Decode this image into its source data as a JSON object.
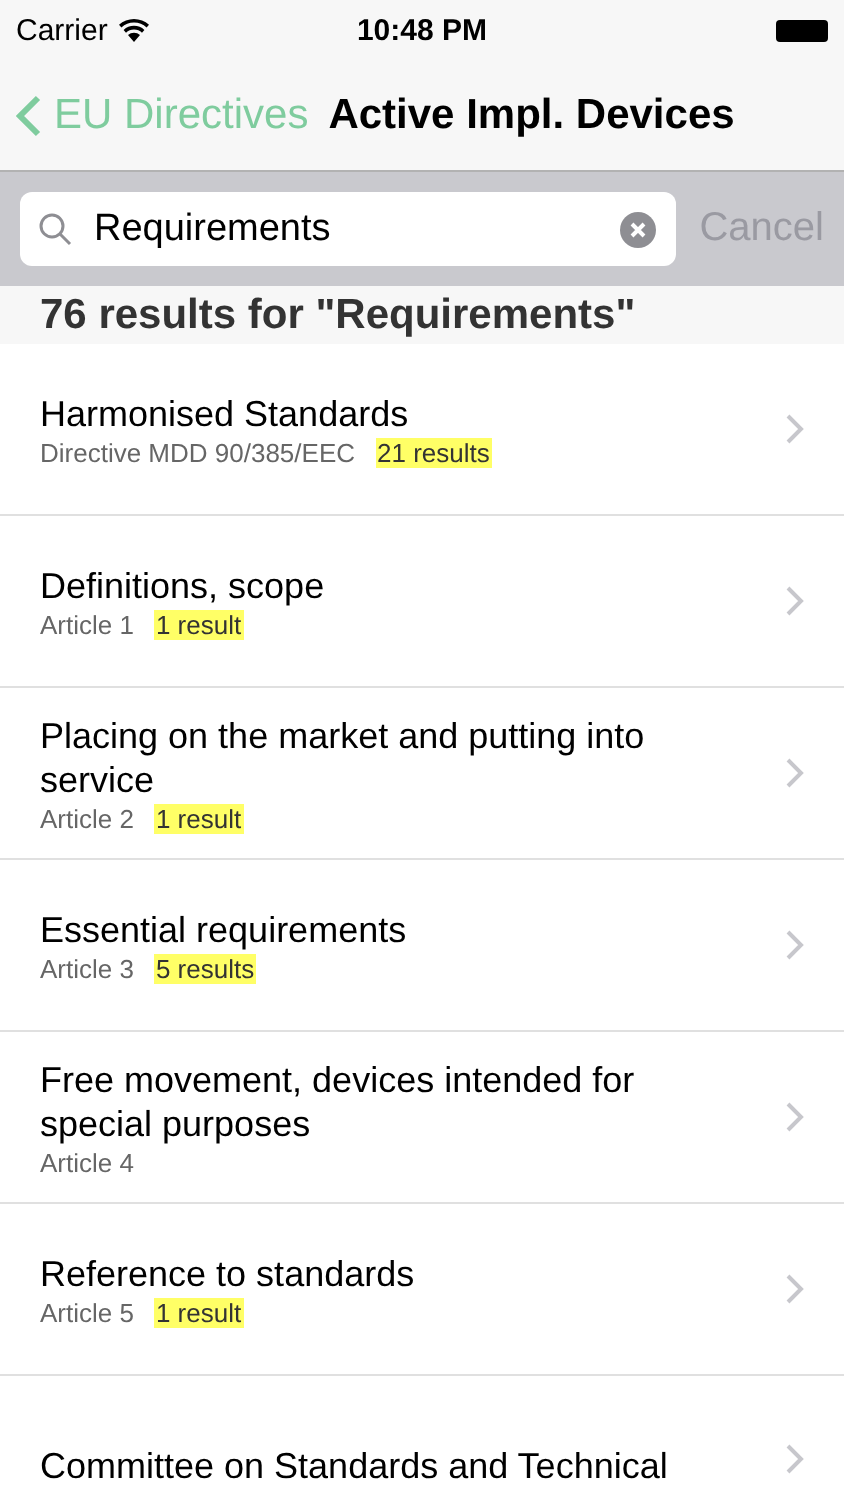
{
  "status_bar": {
    "carrier": "Carrier",
    "time": "10:48 PM"
  },
  "nav_bar": {
    "back": "EU Directives",
    "title": "Active Impl. Devices"
  },
  "search": {
    "value": "Requirements",
    "cancel": "Cancel"
  },
  "results_header": "76 results for \"Requirements\"",
  "rows": [
    {
      "title": "Harmonised Standards",
      "subtitle": "Directive MDD 90/385/EEC",
      "badge": "21 results"
    },
    {
      "title": "Definitions, scope",
      "subtitle": "Article 1",
      "badge": "1 result"
    },
    {
      "title": "Placing on the market and putting into service",
      "subtitle": "Article 2",
      "badge": "1 result"
    },
    {
      "title": "Essential requirements",
      "subtitle": "Article 3",
      "badge": "5 results"
    },
    {
      "title": "Free movement, devices intended for special purposes",
      "subtitle": "Article 4"
    },
    {
      "title": "Reference to standards",
      "subtitle": "Article 5",
      "badge": "1 result"
    },
    {
      "title": "Committee on Standards and Technical"
    }
  ]
}
